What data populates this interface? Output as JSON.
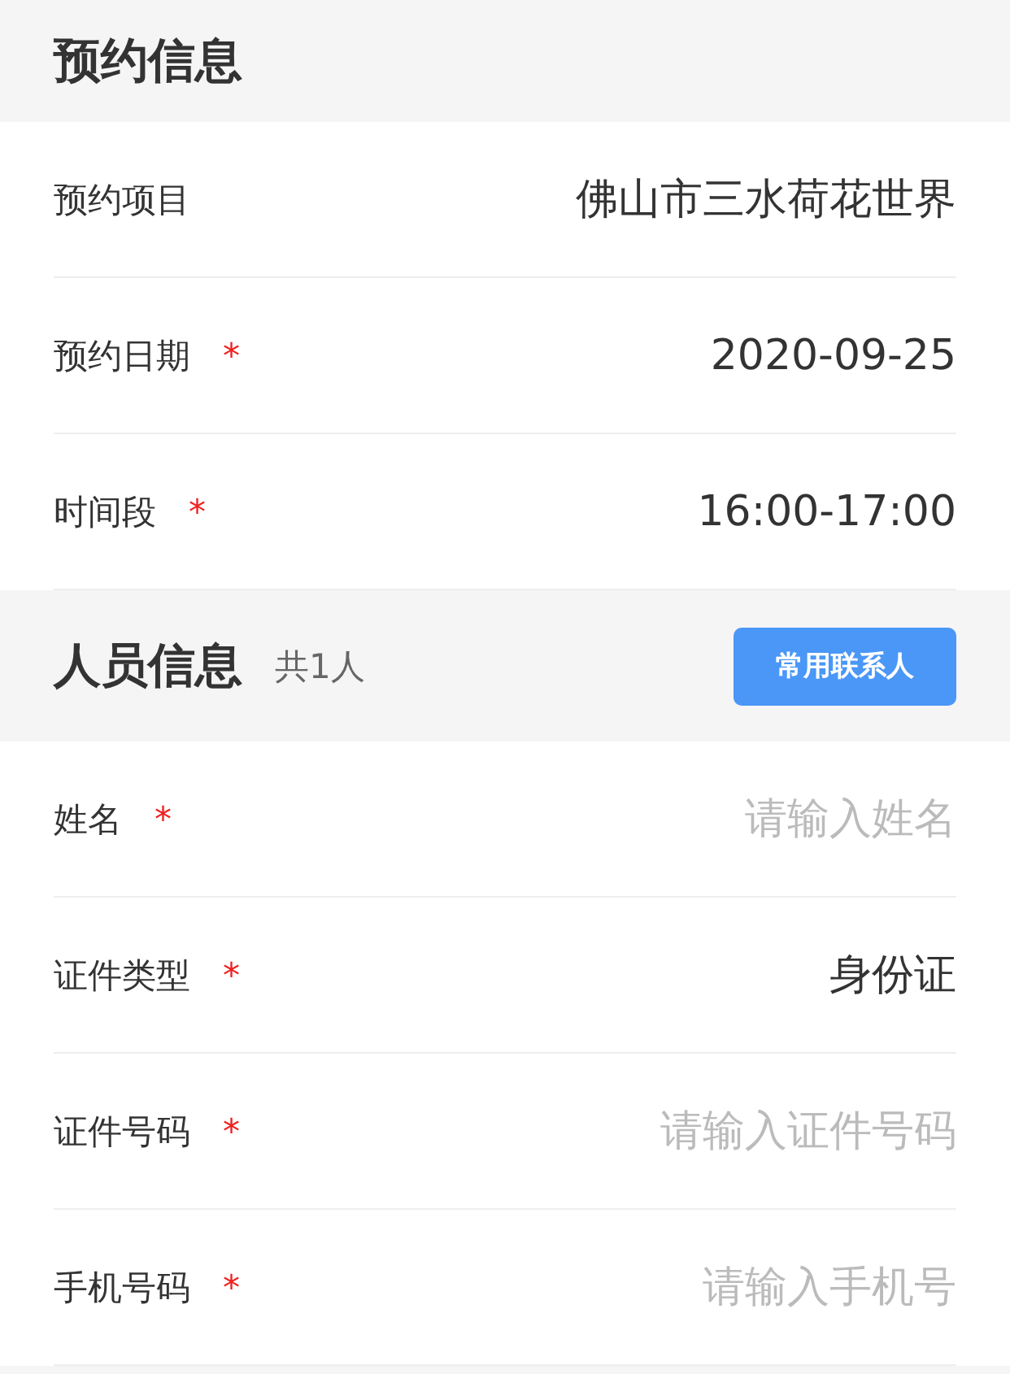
{
  "sections": [
    {
      "title": "预约信息",
      "rows": [
        {
          "label": "预约项目",
          "value": "佛山市三水荷花世界"
        },
        {
          "label": "预约日期",
          "mark": "*",
          "value": "2020-09-25"
        },
        {
          "label": "时间段",
          "mark": "*",
          "value": "16:00-17:00"
        }
      ]
    },
    {
      "title": "人员信息",
      "count": "共1人",
      "button": "常用联系人",
      "rows": [
        {
          "label": "姓名",
          "mark": "*",
          "placeholder": "请输入姓名"
        },
        {
          "label": "证件类型",
          "mark": "*",
          "value": "身份证"
        },
        {
          "label": "证件号码",
          "mark": "*",
          "placeholder": "请输入证件号码"
        },
        {
          "label": "手机号码",
          "mark": "*",
          "placeholder": "请输入手机号"
        }
      ]
    }
  ]
}
